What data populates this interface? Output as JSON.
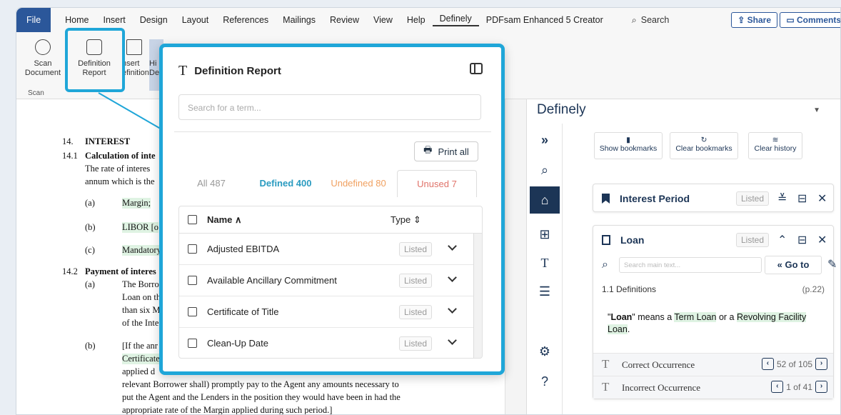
{
  "menu": {
    "file": "File",
    "home": "Home",
    "insert": "Insert",
    "design": "Design",
    "layout": "Layout",
    "references": "References",
    "mailings": "Mailings",
    "review": "Review",
    "view": "View",
    "help": "Help",
    "definely": "Definely",
    "pdfsam": "PDFsam Enhanced 5 Creator",
    "search": "Search",
    "share": "Share",
    "comments": "Comments"
  },
  "ribbon": {
    "scan_document": [
      "Scan",
      "Document"
    ],
    "definition_report": [
      "Definition",
      "Report"
    ],
    "insert_definition": [
      "nsert",
      "efinition"
    ],
    "highlight": [
      "Hi",
      "De"
    ],
    "scan_group": "Scan"
  },
  "document": {
    "lines": [
      {
        "num": "14.",
        "text": "INTEREST",
        "bold": true
      },
      {
        "num": "14.1",
        "text": "Calculation of inte",
        "bold": true
      },
      {
        "num": "",
        "text": "The rate of interes"
      },
      {
        "num": "",
        "text": "annum which is the"
      },
      {
        "num": "(a)",
        "text": "Margin;"
      },
      {
        "num": "(b)",
        "text": "LIBOR [o"
      },
      {
        "num": "(c)",
        "text": "Mandatory"
      },
      {
        "num": "14.2",
        "text": "Payment of interes",
        "bold": true
      },
      {
        "num": "(a)",
        "text": "The Borro"
      },
      {
        "num": "",
        "text": "Loan on th"
      },
      {
        "num": "",
        "text": "than six M"
      },
      {
        "num": "",
        "text": "of the Inte"
      },
      {
        "num": "(b)",
        "text": "[If the anr"
      },
      {
        "num": "",
        "text": "Certificate"
      },
      {
        "num": "",
        "text": "applied d"
      },
      {
        "num": "",
        "text": "relevant Borrower shall) promptly pay to the Agent any amounts necessary to"
      },
      {
        "num": "",
        "text": "put the Agent and the Lenders in the position they would have been in had the"
      },
      {
        "num": "",
        "text": "appropriate rate of the Margin applied during such period.]"
      }
    ]
  },
  "modal": {
    "title": "Definition Report",
    "search_placeholder": "Search for a term...",
    "print_all": "Print all",
    "tabs": {
      "all": "All 487",
      "defined": "Defined 400",
      "undefined": "Undefined 80",
      "unused": "Unused 7"
    },
    "col_name": "Name",
    "col_type": "Type",
    "rows": [
      {
        "name": "Adjusted EBITDA",
        "type": "Listed"
      },
      {
        "name": "Available Ancillary Commitment",
        "type": "Listed"
      },
      {
        "name": "Certificate of Title",
        "type": "Listed"
      },
      {
        "name": "Clean-Up Date",
        "type": "Listed"
      }
    ]
  },
  "definely": {
    "title": "Definely",
    "show_bookmarks": "Show bookmarks",
    "clear_bookmarks": "Clear bookmarks",
    "clear_history": "Clear history",
    "card1": {
      "title": "Interest Period",
      "badge": "Listed"
    },
    "card2": {
      "title": "Loan",
      "badge": "Listed",
      "search_placeholder": "Search main text...",
      "goto": "Go to",
      "section": "1.1 Definitions",
      "page": "(p.22)",
      "def_q1": "\"",
      "def_term": "Loan",
      "def_q2": "\" means a ",
      "def_link1": "Term Loan",
      "def_or": " or a ",
      "def_link2": "Revolving Facility Loan",
      "def_end": ".",
      "correct_label": "Correct Occurrence",
      "correct_count": "52 of 105",
      "incorrect_label": "Incorrect Occurrence",
      "incorrect_count": "1 of 41"
    }
  },
  "colors": {
    "accent": "#1fa6d8",
    "navy": "#1c3556",
    "word_blue": "#2b579a",
    "defined": "#2a9bc0",
    "undefined": "#f0a060",
    "unused": "#e0736a"
  }
}
